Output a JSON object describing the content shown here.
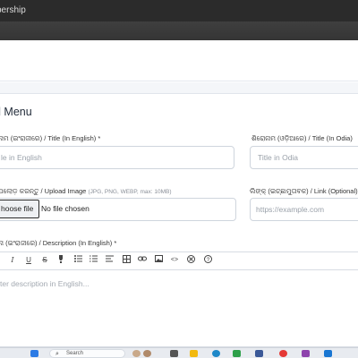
{
  "window": {
    "title": "bership"
  },
  "form": {
    "heading": "d Menu",
    "title_en_label": "ନାମ (ଇଂରାଜୀରେ) / Title (In English) *",
    "title_en_placeholder": "le in English",
    "title_or_label": "ଶିରୋନାମ (ଓଡ଼ିଆରେ) / Title (In Odia)",
    "title_or_placeholder": "Title in Odia",
    "image_label": "ପଲୋଡ଼ କରନ୍ତୁ / Upload Image",
    "image_hint": "(JPG, PNG, WEBP, max: 10MB)",
    "file_button": "hoose file",
    "file_status": "No file chosen",
    "link_label": "ଲିଙ୍କ୍ (ଇଚ୍ଛାମୁତାବକ) / Link (Optional)",
    "link_placeholder": "https://example.com",
    "desc_label": "ନା (ଇଂରାଜୀରେ) / Description (In English) *",
    "desc_placeholder": "ter description in English..."
  },
  "editor_toolbar": [
    "italic-icon",
    "underline-icon",
    "strikethrough-icon",
    "highlight-icon",
    "bullet-list-icon",
    "ordered-list-icon",
    "align-icon",
    "table-icon",
    "link-icon",
    "image-icon",
    "code-icon",
    "clear-format-icon",
    "help-icon"
  ],
  "taskbar": {
    "search_label": "Search"
  }
}
